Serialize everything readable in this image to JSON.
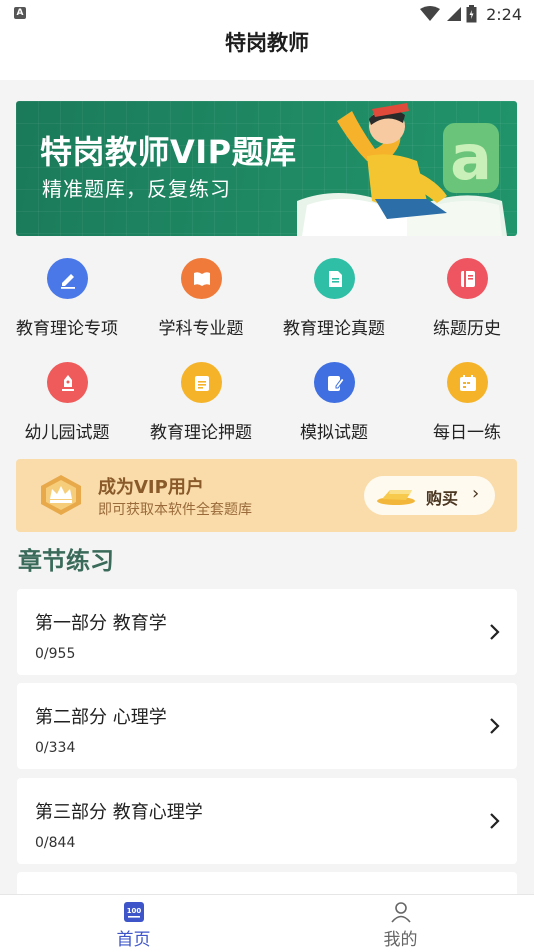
{
  "status_bar": {
    "indicator": "A",
    "time": "2:24",
    "icons": [
      "wifi-icon",
      "signal-icon",
      "battery-icon"
    ]
  },
  "header": {
    "title": "特岗教师"
  },
  "banner": {
    "title": "特岗教师VIP题库",
    "subtitle": "精准题库，反复练习"
  },
  "menu": [
    {
      "label": "教育理论专项",
      "icon": "pen-edit-icon",
      "color": "#4a78e8"
    },
    {
      "label": "学科专业题",
      "icon": "book-icon",
      "color": "#f07a3a"
    },
    {
      "label": "教育理论真题",
      "icon": "document-icon",
      "color": "#2ebfa6"
    },
    {
      "label": "练题历史",
      "icon": "history-book-icon",
      "color": "#ef5560"
    },
    {
      "label": "幼儿园试题",
      "icon": "pencil-icon",
      "color": "#ef5a5a"
    },
    {
      "label": "教育理论押题",
      "icon": "note-icon",
      "color": "#f5b32a"
    },
    {
      "label": "模拟试题",
      "icon": "edit-doc-icon",
      "color": "#3f6fe0"
    },
    {
      "label": "每日一练",
      "icon": "calendar-icon",
      "color": "#f5b32a"
    }
  ],
  "vip": {
    "title": "成为VIP用户",
    "subtitle": "即可获取本软件全套题库",
    "button_label": "购买"
  },
  "section": {
    "title": "章节练习"
  },
  "chapters": [
    {
      "title": "第一部分 教育学",
      "progress": "0/955"
    },
    {
      "title": "第二部分 心理学",
      "progress": "0/334"
    },
    {
      "title": "第三部分 教育心理学",
      "progress": "0/844"
    }
  ],
  "tabs": [
    {
      "label": "首页",
      "icon": "home-100-icon",
      "active": true
    },
    {
      "label": "我的",
      "icon": "user-icon",
      "active": false
    }
  ]
}
